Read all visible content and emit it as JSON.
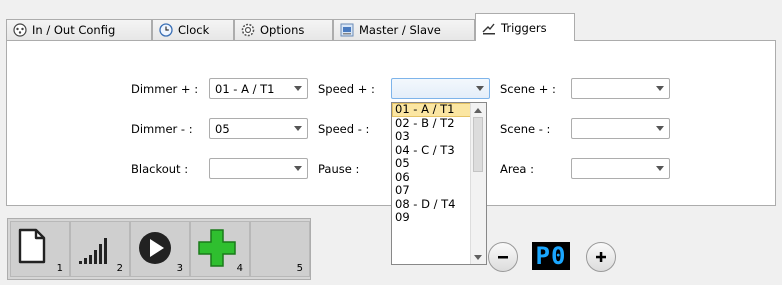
{
  "tabs": [
    {
      "label": "In / Out Config",
      "icon": "inout-config-icon"
    },
    {
      "label": "Clock",
      "icon": "clock-icon"
    },
    {
      "label": "Options",
      "icon": "gear-icon"
    },
    {
      "label": "Master / Slave",
      "icon": "master-slave-icon"
    },
    {
      "label": "Triggers",
      "icon": "triggers-icon",
      "active": true
    }
  ],
  "triggers": {
    "dimmer_plus_label": "Dimmer + :",
    "dimmer_plus_value": "01 - A / T1",
    "dimmer_minus_label": "Dimmer - :",
    "dimmer_minus_value": "05",
    "blackout_label": "Blackout :",
    "blackout_value": "",
    "speed_plus_label": "Speed + :",
    "speed_plus_value": "",
    "speed_minus_label": "Speed - :",
    "pause_label": "Pause :",
    "scene_plus_label": "Scene + :",
    "scene_plus_value": "",
    "scene_minus_label": "Scene - :",
    "scene_minus_value": "",
    "area_label": "Area :",
    "area_value": ""
  },
  "dropdown": {
    "items": [
      "01 - A / T1",
      "02 - B / T2",
      "03",
      "04 - C / T3",
      "05",
      "06",
      "07",
      "08 - D / T4",
      "09"
    ],
    "selected_index": 0
  },
  "cues": [
    {
      "num": "1",
      "icon": "new-document-icon"
    },
    {
      "num": "2",
      "icon": "signal-bars-icon"
    },
    {
      "num": "3",
      "icon": "play-icon"
    },
    {
      "num": "4",
      "icon": "green-plus-icon"
    },
    {
      "num": "5",
      "icon": ""
    }
  ],
  "page": {
    "display": "P0",
    "minus_label": "-",
    "plus_label": "+"
  },
  "colors": {
    "selected_item": "#fbe6a2",
    "lcd_text": "#1aa7ff",
    "plus_green": "#2fbf2f"
  }
}
